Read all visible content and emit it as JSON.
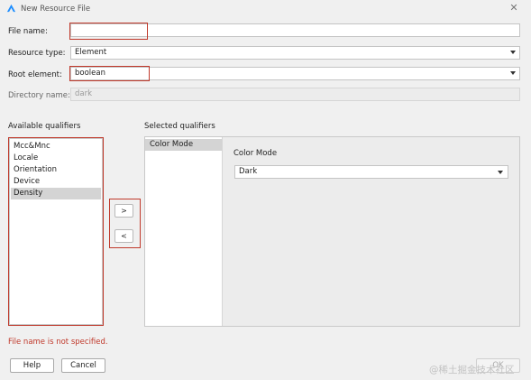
{
  "window": {
    "title": "New Resource File",
    "accent_color": "#1f8fff"
  },
  "form": {
    "file_name": {
      "label": "File name:",
      "value": ""
    },
    "resource_type": {
      "label": "Resource type:",
      "value": "Element"
    },
    "root_element": {
      "label": "Root element:",
      "value": "boolean"
    },
    "directory_name": {
      "label": "Directory name:",
      "value": "dark"
    }
  },
  "qualifiers": {
    "available_label": "Available qualifiers",
    "selected_label": "Selected qualifiers",
    "available": [
      "Mcc&Mnc",
      "Locale",
      "Orientation",
      "Device",
      "Density"
    ],
    "available_selected": "Density",
    "selected": [
      "Color Mode"
    ],
    "move_right": ">",
    "move_left": "<",
    "detail": {
      "label": "Color Mode",
      "value": "Dark"
    }
  },
  "status": {
    "error": "File name is not specified.",
    "error_color": "#c0392b"
  },
  "buttons": {
    "help": "Help",
    "cancel": "Cancel",
    "ok": "OK"
  },
  "watermark": "@稀土掘金技术社区"
}
